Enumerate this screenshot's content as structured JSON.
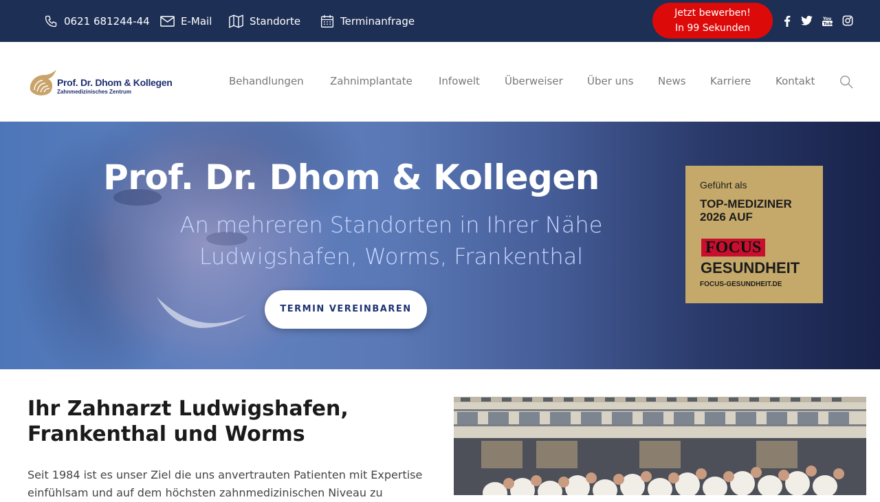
{
  "topbar": {
    "phone": "0621 681244-44",
    "email": "E-Mail",
    "locations": "Standorte",
    "appointment": "Terminanfrage",
    "apply_line1": "Jetzt bewerben!",
    "apply_line2": "In 99 Sekunden",
    "social_icons": [
      "facebook-icon",
      "twitter-icon",
      "youtube-icon",
      "instagram-icon"
    ]
  },
  "header": {
    "logo_name": "Prof. Dr. Dhom & Kollegen",
    "logo_sub": "Zahnmedizinisches Zentrum",
    "nav": [
      "Behandlungen",
      "Zahnimplantate",
      "Infowelt",
      "Überweiser",
      "Über uns",
      "News",
      "Karriere",
      "Kontakt"
    ]
  },
  "hero": {
    "title": "Prof. Dr. Dhom & Kollegen",
    "subtitle_line1": "An mehreren Standorten in Ihrer Nähe",
    "subtitle_line2": "Ludwigshafen, Worms, Frankenthal",
    "button": "TERMIN VEREINBAREN",
    "badge": {
      "line1": "Geführt als",
      "line2": "TOP-MEDIZINER 2026 AUF",
      "focus": "FOCUS",
      "line3": "GESUNDHEIT",
      "line4": "FOCUS-GESUNDHEIT.DE"
    }
  },
  "content": {
    "heading": "Ihr Zahnarzt Ludwigshafen, Frankenthal und Worms",
    "body": "Seit 1984 ist es unser Ziel die uns anvertrauten Patienten mit Expertise einfühlsam und auf dem höchsten zahnmedizinischen Niveau zu"
  },
  "colors": {
    "topbar_bg": "#1e2f55",
    "apply_button": "#dd0a0a",
    "nav_text": "#777777",
    "brand_navy": "#1e3473",
    "badge_gold": "#c5a96a"
  }
}
